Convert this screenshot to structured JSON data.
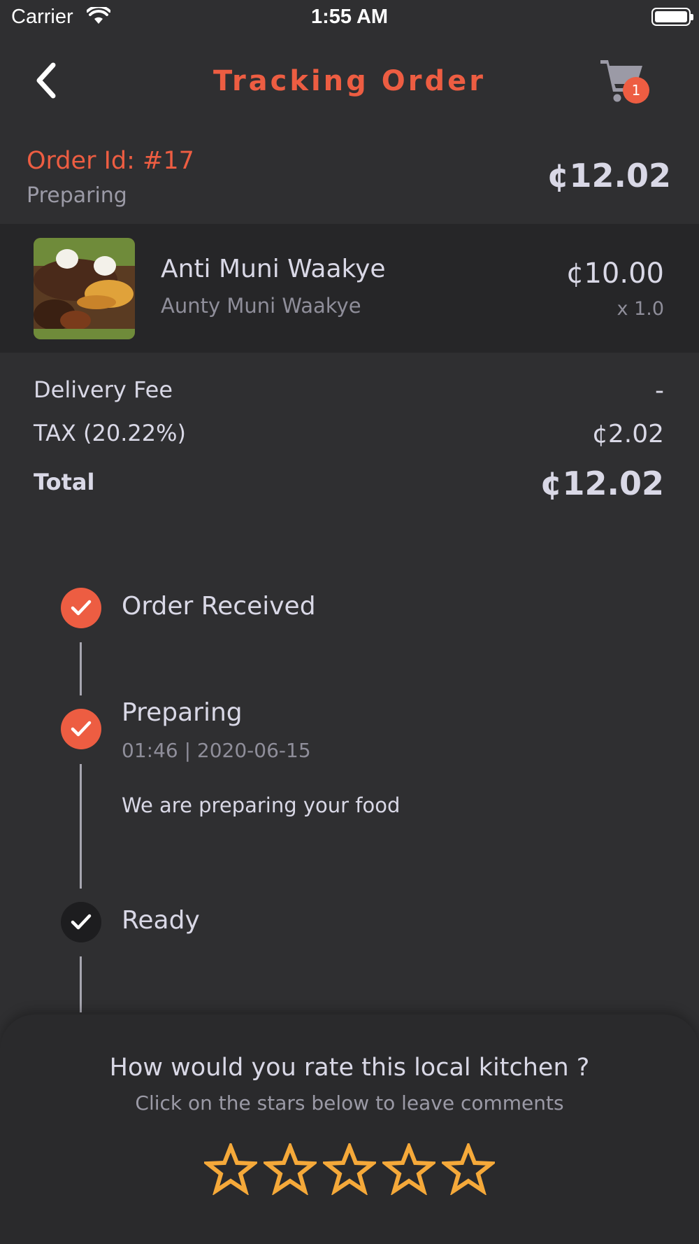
{
  "status_bar": {
    "carrier": "Carrier",
    "time": "1:55 AM"
  },
  "header": {
    "title": "Tracking Order",
    "cart_count": "1"
  },
  "order": {
    "id_label": "Order Id: #17",
    "status": "Preparing",
    "total": "¢12.02"
  },
  "item": {
    "name": "Anti Muni Waakye",
    "vendor": "Aunty Muni Waakye",
    "price": "¢10.00",
    "quantity": "x 1.0"
  },
  "fees": {
    "delivery_label": "Delivery Fee",
    "delivery_value": "-",
    "tax_label": "TAX (20.22%)",
    "tax_value": "¢2.02",
    "total_label": "Total",
    "total_value": "¢12.02"
  },
  "timeline": [
    {
      "title": "Order Received",
      "state": "done"
    },
    {
      "title": "Preparing",
      "time": "01:46 | 2020-06-15",
      "description": "We are preparing your food",
      "state": "done"
    },
    {
      "title": "Ready",
      "state": "pending"
    }
  ],
  "rating": {
    "title": "How would you rate this local kitchen ?",
    "subtitle": "Click on the stars below to leave comments",
    "stars": 5,
    "selected": 0
  },
  "colors": {
    "accent": "#ed5d42",
    "star": "#f5a93a",
    "background": "#2f2f31"
  },
  "icons": [
    "wifi-icon",
    "battery-icon",
    "back-chevron-icon",
    "cart-icon",
    "check-icon",
    "star-outline-icon"
  ]
}
